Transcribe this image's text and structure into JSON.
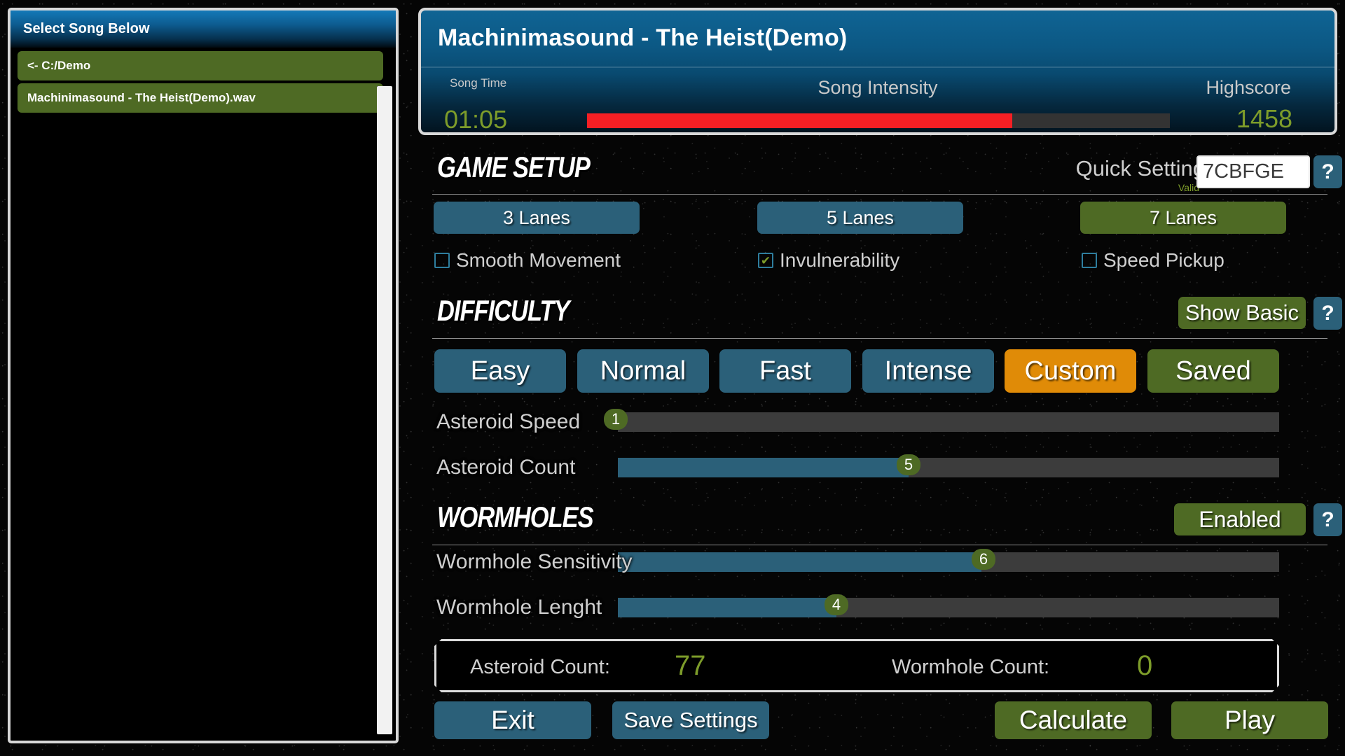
{
  "song_list": {
    "header": "Select Song Below",
    "parent_dir": "<- C:/Demo",
    "items": [
      {
        "name": "Machinimasound - The Heist(Demo).wav"
      }
    ]
  },
  "now_playing": {
    "title": "Machinimasound - The Heist(Demo)",
    "song_time_label": "Song Time",
    "song_time_value": "01:05",
    "song_intensity_label": "Song Intensity",
    "song_intensity_percent": 73,
    "highscore_label": "Highscore",
    "highscore_value": "1458"
  },
  "game_setup": {
    "title": "GAME SETUP",
    "quick_setting_label": "Quick Setting",
    "quick_setting_value": "7CBFGE",
    "quick_setting_status": "Valid",
    "help_label": "?",
    "lanes": [
      {
        "label": "3 Lanes",
        "selected": false
      },
      {
        "label": "5 Lanes",
        "selected": false
      },
      {
        "label": "7 Lanes",
        "selected": true
      }
    ],
    "checkboxes": [
      {
        "label": "Smooth Movement",
        "checked": false,
        "mark": ""
      },
      {
        "label": "Invulnerability",
        "checked": true,
        "mark": "✔"
      },
      {
        "label": "Speed Pickup",
        "checked": false,
        "mark": ""
      }
    ]
  },
  "difficulty": {
    "title": "DIFFICULTY",
    "toggle_label": "Show Basic",
    "help_label": "?",
    "presets": [
      {
        "label": "Easy",
        "state": "normal"
      },
      {
        "label": "Normal",
        "state": "normal"
      },
      {
        "label": "Fast",
        "state": "normal"
      },
      {
        "label": "Intense",
        "state": "normal"
      },
      {
        "label": "Custom",
        "state": "active"
      },
      {
        "label": "Saved",
        "state": "saved"
      }
    ],
    "sliders": [
      {
        "label": "Asteroid Speed",
        "value": "1",
        "percent": 0
      },
      {
        "label": "Asteroid Count",
        "value": "5",
        "percent": 44
      }
    ]
  },
  "wormholes": {
    "title": "WORMHOLES",
    "toggle_label": "Enabled",
    "help_label": "?",
    "sliders": [
      {
        "label": "Wormhole Sensitivity",
        "value": "6",
        "percent": 55
      },
      {
        "label": "Wormhole Lenght",
        "value": "4",
        "percent": 33
      }
    ]
  },
  "summary": {
    "asteroid_count_label": "Asteroid Count:",
    "asteroid_count_value": "77",
    "wormhole_count_label": "Wormhole Count:",
    "wormhole_count_value": "0"
  },
  "footer": {
    "exit": "Exit",
    "save_settings": "Save Settings",
    "calculate": "Calculate",
    "play": "Play"
  },
  "colors": {
    "blue": "#2b6079",
    "green": "#4e6a24",
    "orange": "#e08b07",
    "value_green": "#7d9c2a",
    "intensity_red": "#f51f24"
  }
}
